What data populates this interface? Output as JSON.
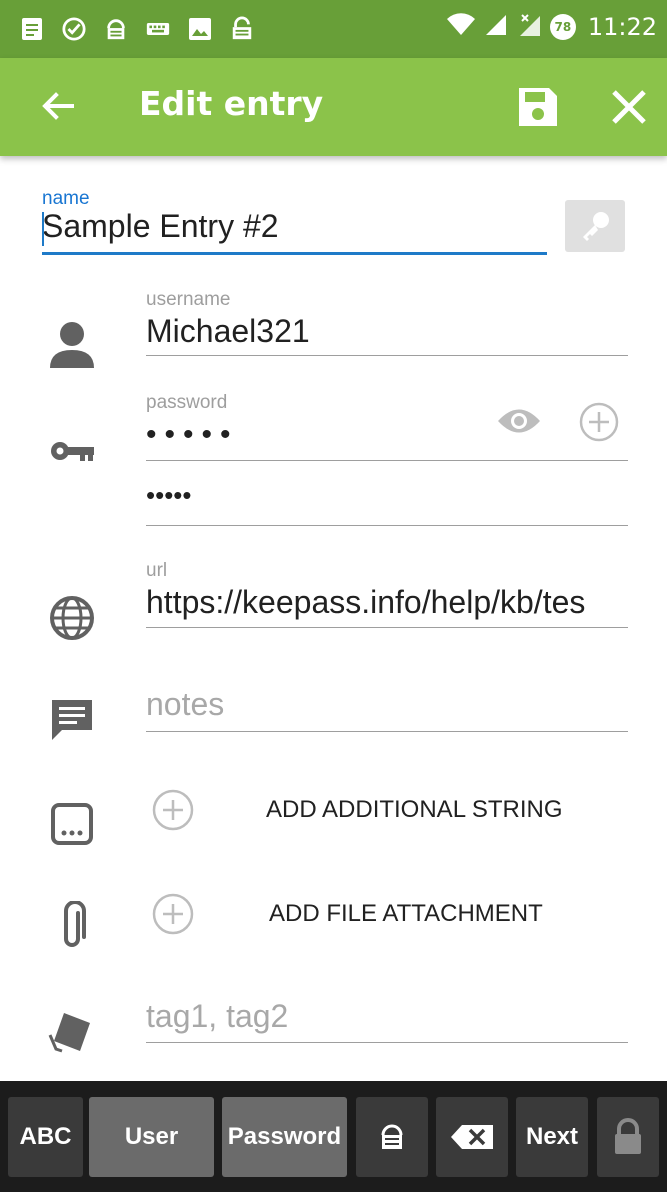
{
  "status_bar": {
    "time": "11:22",
    "battery_level": "78"
  },
  "app_bar": {
    "title": "Edit entry"
  },
  "form": {
    "name": {
      "label": "name",
      "value": "Sample Entry #2"
    },
    "username": {
      "label": "username",
      "value": "Michael321"
    },
    "password": {
      "label": "password",
      "value": "•••••",
      "confirm_value": "•••••"
    },
    "url": {
      "label": "url",
      "value": "https://keepass.info/help/kb/tes"
    },
    "notes": {
      "placeholder": "notes"
    },
    "tags": {
      "placeholder": "tag1, tag2"
    },
    "add_string_label": "ADD ADDITIONAL STRING",
    "add_file_label": "ADD FILE ATTACHMENT"
  },
  "keyboard_bar": {
    "abc": "ABC",
    "user": "User",
    "password": "Password",
    "next": "Next"
  },
  "colors": {
    "status_bar": "#689f38",
    "app_bar": "#8bc34a",
    "accent": "#1e7ac8"
  }
}
